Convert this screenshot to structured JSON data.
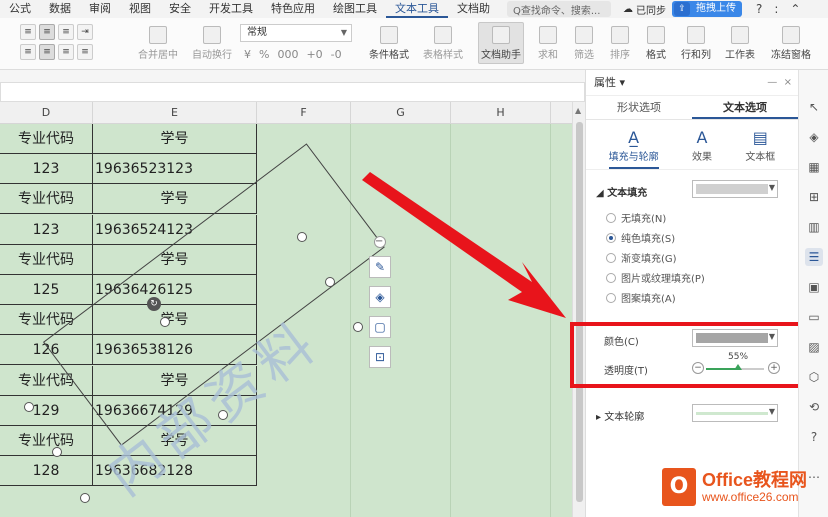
{
  "menu": {
    "items": [
      "公式",
      "数据",
      "审阅",
      "视图",
      "安全",
      "开发工具",
      "特色应用",
      "绘图工具",
      "文本工具",
      "文档助"
    ],
    "active_index": 8,
    "search_placeholder": "Q查找命令、搜索...",
    "sync_label": "已同步",
    "upload_label": "拖拽上传",
    "icons": [
      "help-icon",
      "more-icon",
      "collapse-icon"
    ]
  },
  "ribbon": {
    "merge_label": "合并居中",
    "wrap_label": "自动换行",
    "number_format": "常规",
    "number_symbols": [
      "¥",
      "%",
      "000",
      "+0",
      "-0"
    ],
    "cond_format_label": "条件格式",
    "table_style_label": "表格样式",
    "doc_assist_label": "文档助手",
    "sum_label": "求和",
    "filter_label": "筛选",
    "sort_label": "排序",
    "format_label": "格式",
    "rowcol_label": "行和列",
    "sheet_label": "工作表",
    "freeze_label": "冻结窗格"
  },
  "sheet": {
    "columns": [
      "D",
      "E",
      "F",
      "G",
      "H"
    ],
    "rows": [
      {
        "d": "专业代码",
        "e": "学号"
      },
      {
        "d": "123",
        "e": "19636523123"
      },
      {
        "d": "专业代码",
        "e": "学号"
      },
      {
        "d": "123",
        "e": "19636524123"
      },
      {
        "d": "专业代码",
        "e": "学号"
      },
      {
        "d": "125",
        "e": "19636426125"
      },
      {
        "d": "专业代码",
        "e": "学号"
      },
      {
        "d": "126",
        "e": "19636538126"
      },
      {
        "d": "专业代码",
        "e": "学号"
      },
      {
        "d": "129",
        "e": "19636674129"
      },
      {
        "d": "专业代码",
        "e": "学号"
      },
      {
        "d": "128",
        "e": "19636682128"
      }
    ],
    "watermark_text": "内部资料"
  },
  "panel": {
    "title": "属性",
    "tabs": [
      "形状选项",
      "文本选项"
    ],
    "active_tab": 1,
    "subtabs": [
      "填充与轮廓",
      "效果",
      "文本框"
    ],
    "text_fill_label": "文本填充",
    "fill_options": [
      "无填充(N)",
      "纯色填充(S)",
      "渐变填充(G)",
      "图片或纹理填充(P)",
      "图案填充(A)"
    ],
    "selected_fill": 1,
    "color_label": "颜色(C)",
    "transparency_label": "透明度(T)",
    "transparency_value": "55%",
    "transparency_fraction": 0.55,
    "text_outline_label": "文本轮廓"
  },
  "colors": {
    "sheet_bg": "#cfe5cd",
    "accent": "#2b5797",
    "annotation_red": "#e8141b",
    "swatch_grey": "#a6a6a6"
  },
  "logo": {
    "brand": "Office教程网",
    "url": "www.office26.com"
  }
}
